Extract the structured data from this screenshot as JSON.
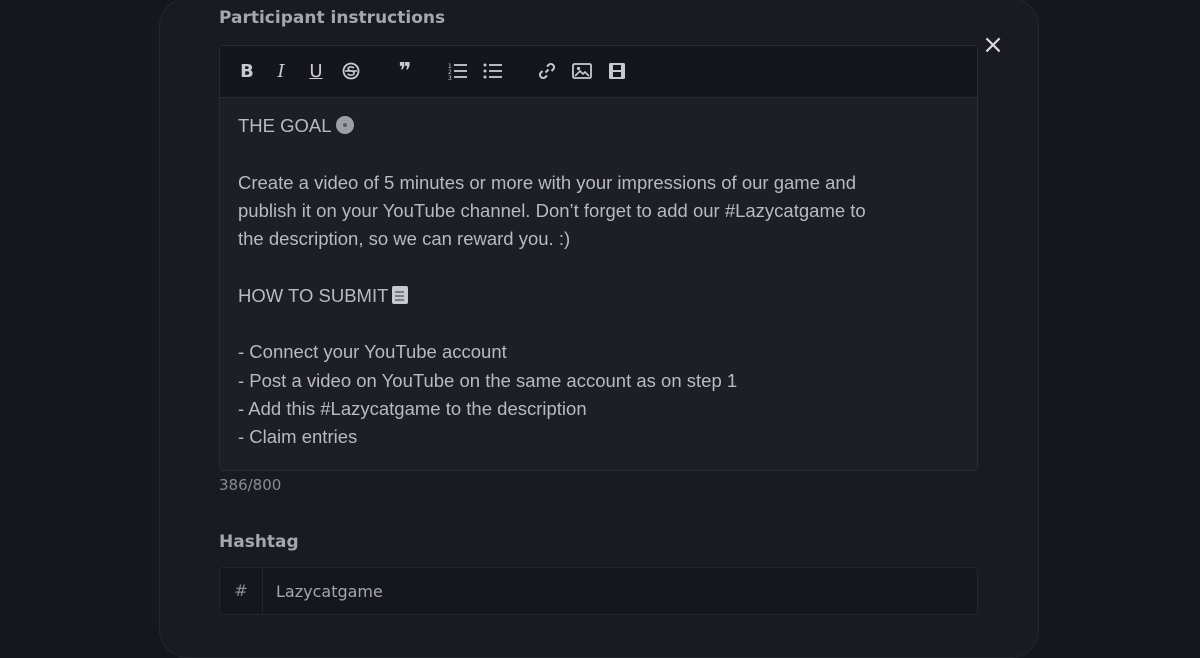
{
  "instructions": {
    "label": "Participant instructions",
    "char_count": "386/800",
    "lines": [
      "THE GOAL",
      "",
      "Create a video of 5 minutes or more with your impressions of our game and",
      "publish it on your YouTube channel. Don’t forget to add our #Lazycatgame to",
      "the description, so we can reward you. :)",
      "",
      "HOW TO SUBMIT",
      "",
      "- Connect your YouTube account",
      "- Post a video on YouTube on the same account as on step 1",
      "- Add this #Lazycatgame to the description",
      "- Claim entries"
    ]
  },
  "toolbar": {
    "bold": "B",
    "italic": "I",
    "underline": "U",
    "quote": "❞",
    "icons": [
      "bold-icon",
      "italic-icon",
      "underline-icon",
      "strikethrough-icon",
      "quote-icon",
      "ordered-list-icon",
      "bullet-list-icon",
      "link-icon",
      "image-icon",
      "video-icon"
    ]
  },
  "hashtag": {
    "label": "Hashtag",
    "prefix": "#",
    "value": "Lazycatgame"
  },
  "close_icon": "×",
  "colors": {
    "background": "#16171d",
    "modal": "#1a1b22",
    "editor": "#1d1e26",
    "toolbar": "#15161c",
    "text": "#b9bac0"
  }
}
